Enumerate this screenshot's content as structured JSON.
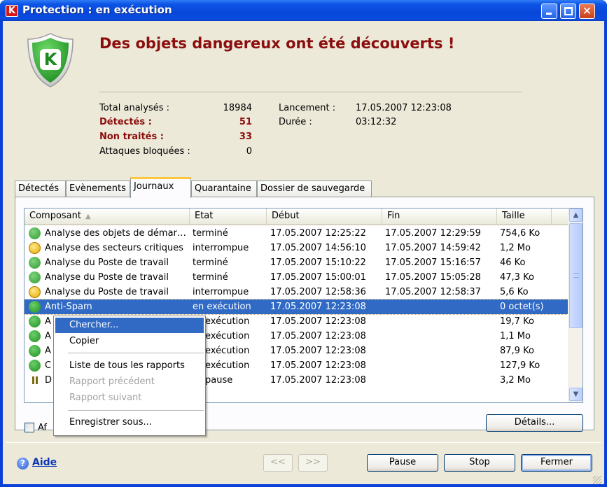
{
  "window": {
    "title": "Protection : en exécution",
    "controls": [
      "minimize",
      "maximize",
      "close"
    ]
  },
  "header": {
    "headline": "Des objets dangereux ont été découverts !",
    "stats": {
      "total_label": "Total analysés :",
      "total_value": "18984",
      "detected_label": "Détectés :",
      "detected_value": "51",
      "untreated_label": "Non traités :",
      "untreated_value": "33",
      "blocked_label": "Attaques bloquées :",
      "blocked_value": "0",
      "launch_label": "Lancement :",
      "launch_value": "17.05.2007 12:23:08",
      "duration_label": "Durée :",
      "duration_value": "03:12:32"
    }
  },
  "tabs": [
    {
      "label": "Détectés",
      "active": false
    },
    {
      "label": "Evènements",
      "active": false
    },
    {
      "label": "Journaux",
      "active": true
    },
    {
      "label": "Quarantaine",
      "active": false
    },
    {
      "label": "Dossier de sauvegarde",
      "active": false
    }
  ],
  "table": {
    "columns": [
      "Composant",
      "Etat",
      "Début",
      "Fin",
      "Taille"
    ],
    "sort_icon": "sort-ascending-icon",
    "rows": [
      {
        "icon": "check",
        "component": "Analyse des objets de démar…",
        "state": "terminé",
        "start": "17.05.2007 12:25:22",
        "end": "17.05.2007 12:29:59",
        "size": "754,6 Ko"
      },
      {
        "icon": "warning",
        "component": "Analyse des secteurs critiques",
        "state": "interrompue",
        "start": "17.05.2007 14:56:10",
        "end": "17.05.2007 14:59:42",
        "size": "1,2 Mo"
      },
      {
        "icon": "check",
        "component": "Analyse du Poste de travail",
        "state": "terminé",
        "start": "17.05.2007 15:10:22",
        "end": "17.05.2007 15:16:57",
        "size": "46 Ko"
      },
      {
        "icon": "check",
        "component": "Analyse du Poste de travail",
        "state": "terminé",
        "start": "17.05.2007 15:00:01",
        "end": "17.05.2007 15:05:28",
        "size": "47,3 Ko"
      },
      {
        "icon": "warning",
        "component": "Analyse du Poste de travail",
        "state": "interrompue",
        "start": "17.05.2007 12:58:36",
        "end": "17.05.2007 12:58:37",
        "size": "5,6 Ko"
      },
      {
        "icon": "play",
        "component": "Anti-Spam",
        "state": "en exécution",
        "start": "17.05.2007 12:23:08",
        "end": "",
        "size": "0 octet(s)",
        "selected": true
      },
      {
        "icon": "play",
        "component": "A",
        "state": "exécution",
        "start": "17.05.2007 12:23:08",
        "end": "",
        "size": "19,7 Ko"
      },
      {
        "icon": "play",
        "component": "A",
        "state": "exécution",
        "start": "17.05.2007 12:23:08",
        "end": "",
        "size": "1,1 Mo"
      },
      {
        "icon": "play",
        "component": "A",
        "state": "exécution",
        "start": "17.05.2007 12:23:08",
        "end": "",
        "size": "87,9 Ko"
      },
      {
        "icon": "play",
        "component": "C",
        "state": "exécution",
        "start": "17.05.2007 12:23:08",
        "end": "",
        "size": "127,9 Ko"
      },
      {
        "icon": "pause",
        "component": "D",
        "state": "pause",
        "start": "17.05.2007 12:23:08",
        "end": "",
        "size": "3,2 Mo"
      }
    ]
  },
  "context_menu": {
    "items": [
      {
        "label": "Chercher...",
        "highlighted": true,
        "disabled": false
      },
      {
        "label": "Copier",
        "highlighted": false,
        "disabled": false
      },
      {
        "label": "Liste de tous les rapports",
        "highlighted": false,
        "disabled": false
      },
      {
        "label": "Rapport précédent",
        "highlighted": false,
        "disabled": true
      },
      {
        "label": "Rapport suivant",
        "highlighted": false,
        "disabled": true
      },
      {
        "label": "Enregistrer sous...",
        "highlighted": false,
        "disabled": false
      }
    ]
  },
  "checkbox": {
    "label": "Af",
    "checked": false
  },
  "buttons": {
    "details": "Détails...",
    "prev": "<<",
    "next": ">>",
    "pause": "Pause",
    "stop": "Stop",
    "close": "Fermer"
  },
  "help": {
    "label": "Aide"
  },
  "colors": {
    "accent": "#8b0e0e",
    "selection": "#316ac5",
    "titlebar": "#0846d8",
    "tab_active": "#ffc83c"
  }
}
